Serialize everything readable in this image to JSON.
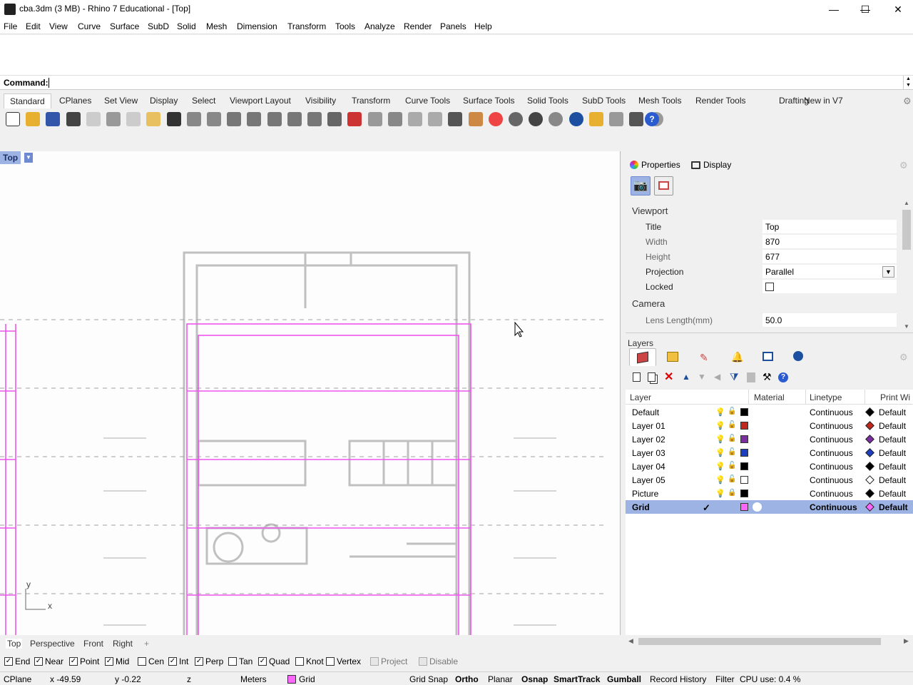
{
  "window": {
    "title": "cba.3dm (3 MB) - Rhino 7 Educational - [Top]",
    "min": "—",
    "max": "☐",
    "close": "✕"
  },
  "menu": [
    "File",
    "Edit",
    "View",
    "Curve",
    "Surface",
    "SubD",
    "Solid",
    "Mesh",
    "Dimension",
    "Transform",
    "Tools",
    "Analyze",
    "Render",
    "Panels",
    "Help"
  ],
  "command": {
    "label": "Command:",
    "value": ""
  },
  "toolbar_tabs": [
    "Standard",
    "CPlanes",
    "Set View",
    "Display",
    "Select",
    "Viewport Layout",
    "Visibility",
    "Transform",
    "Curve Tools",
    "Surface Tools",
    "Solid Tools",
    "SubD Tools",
    "Mesh Tools",
    "Render Tools",
    "Drafting",
    "New in V7"
  ],
  "viewport": {
    "title": "Top",
    "axis_x": "x",
    "axis_y": "y",
    "tabs": [
      "Top",
      "Perspective",
      "Front",
      "Right"
    ],
    "add_tab": "+"
  },
  "properties": {
    "tabs": [
      "Properties",
      "Display"
    ],
    "section_viewport": "Viewport",
    "section_camera": "Camera",
    "rows": [
      {
        "key": "Title",
        "value": "Top"
      },
      {
        "key": "Width",
        "value": "870"
      },
      {
        "key": "Height",
        "value": "677"
      },
      {
        "key": "Projection",
        "value": "Parallel"
      },
      {
        "key": "Locked",
        "value": ""
      },
      {
        "key": "Lens Length(mm)",
        "value": "50.0"
      }
    ]
  },
  "layers": {
    "title": "Layers",
    "headers": [
      "Layer",
      "Material",
      "Linetype",
      "Print Wi"
    ],
    "rows": [
      {
        "name": "Default",
        "color": "#000000",
        "linetype": "Continuous",
        "print": "Default",
        "diamond": "#000000",
        "locked": false
      },
      {
        "name": "Layer 01",
        "color": "#c0281c",
        "linetype": "Continuous",
        "print": "Default",
        "diamond": "#c0281c",
        "locked": false
      },
      {
        "name": "Layer 02",
        "color": "#7a2ea0",
        "linetype": "Continuous",
        "print": "Default",
        "diamond": "#7a2ea0",
        "locked": false
      },
      {
        "name": "Layer 03",
        "color": "#1c3fc0",
        "linetype": "Continuous",
        "print": "Default",
        "diamond": "#1c3fc0",
        "locked": false
      },
      {
        "name": "Layer 04",
        "color": "#000000",
        "linetype": "Continuous",
        "print": "Default",
        "diamond": "#000000",
        "locked": false
      },
      {
        "name": "Layer 05",
        "color": "#ffffff",
        "linetype": "Continuous",
        "print": "Default",
        "diamond": "#ffffff",
        "locked": false
      },
      {
        "name": "Picture",
        "color": "#000000",
        "linetype": "Continuous",
        "print": "Default",
        "diamond": "#000000",
        "locked": true
      },
      {
        "name": "Grid",
        "color": "#ff66ff",
        "linetype": "Continuous",
        "print": "Default",
        "diamond": "#ff66ff",
        "locked": false,
        "current": "✓"
      }
    ]
  },
  "osnaps": [
    {
      "label": "End",
      "checked": true
    },
    {
      "label": "Near",
      "checked": true
    },
    {
      "label": "Point",
      "checked": true
    },
    {
      "label": "Mid",
      "checked": true
    },
    {
      "label": "Cen",
      "checked": false
    },
    {
      "label": "Int",
      "checked": true
    },
    {
      "label": "Perp",
      "checked": true
    },
    {
      "label": "Tan",
      "checked": false
    },
    {
      "label": "Quad",
      "checked": true
    },
    {
      "label": "Knot",
      "checked": false
    },
    {
      "label": "Vertex",
      "checked": false
    },
    {
      "label": "Project",
      "checked": false,
      "disabled": true
    },
    {
      "label": "Disable",
      "checked": false,
      "disabled": true
    }
  ],
  "status": {
    "cplane": "CPlane",
    "x": "x -49.59",
    "y": "y -0.22",
    "z": "z",
    "units": "Meters",
    "layer": "Grid",
    "layer_color": "#ff66ff",
    "toggles": [
      "Grid Snap",
      "Ortho",
      "Planar",
      "Osnap",
      "SmartTrack",
      "Gumball",
      "Record History",
      "Filter"
    ],
    "cpu": "CPU use: 0.4 %"
  }
}
